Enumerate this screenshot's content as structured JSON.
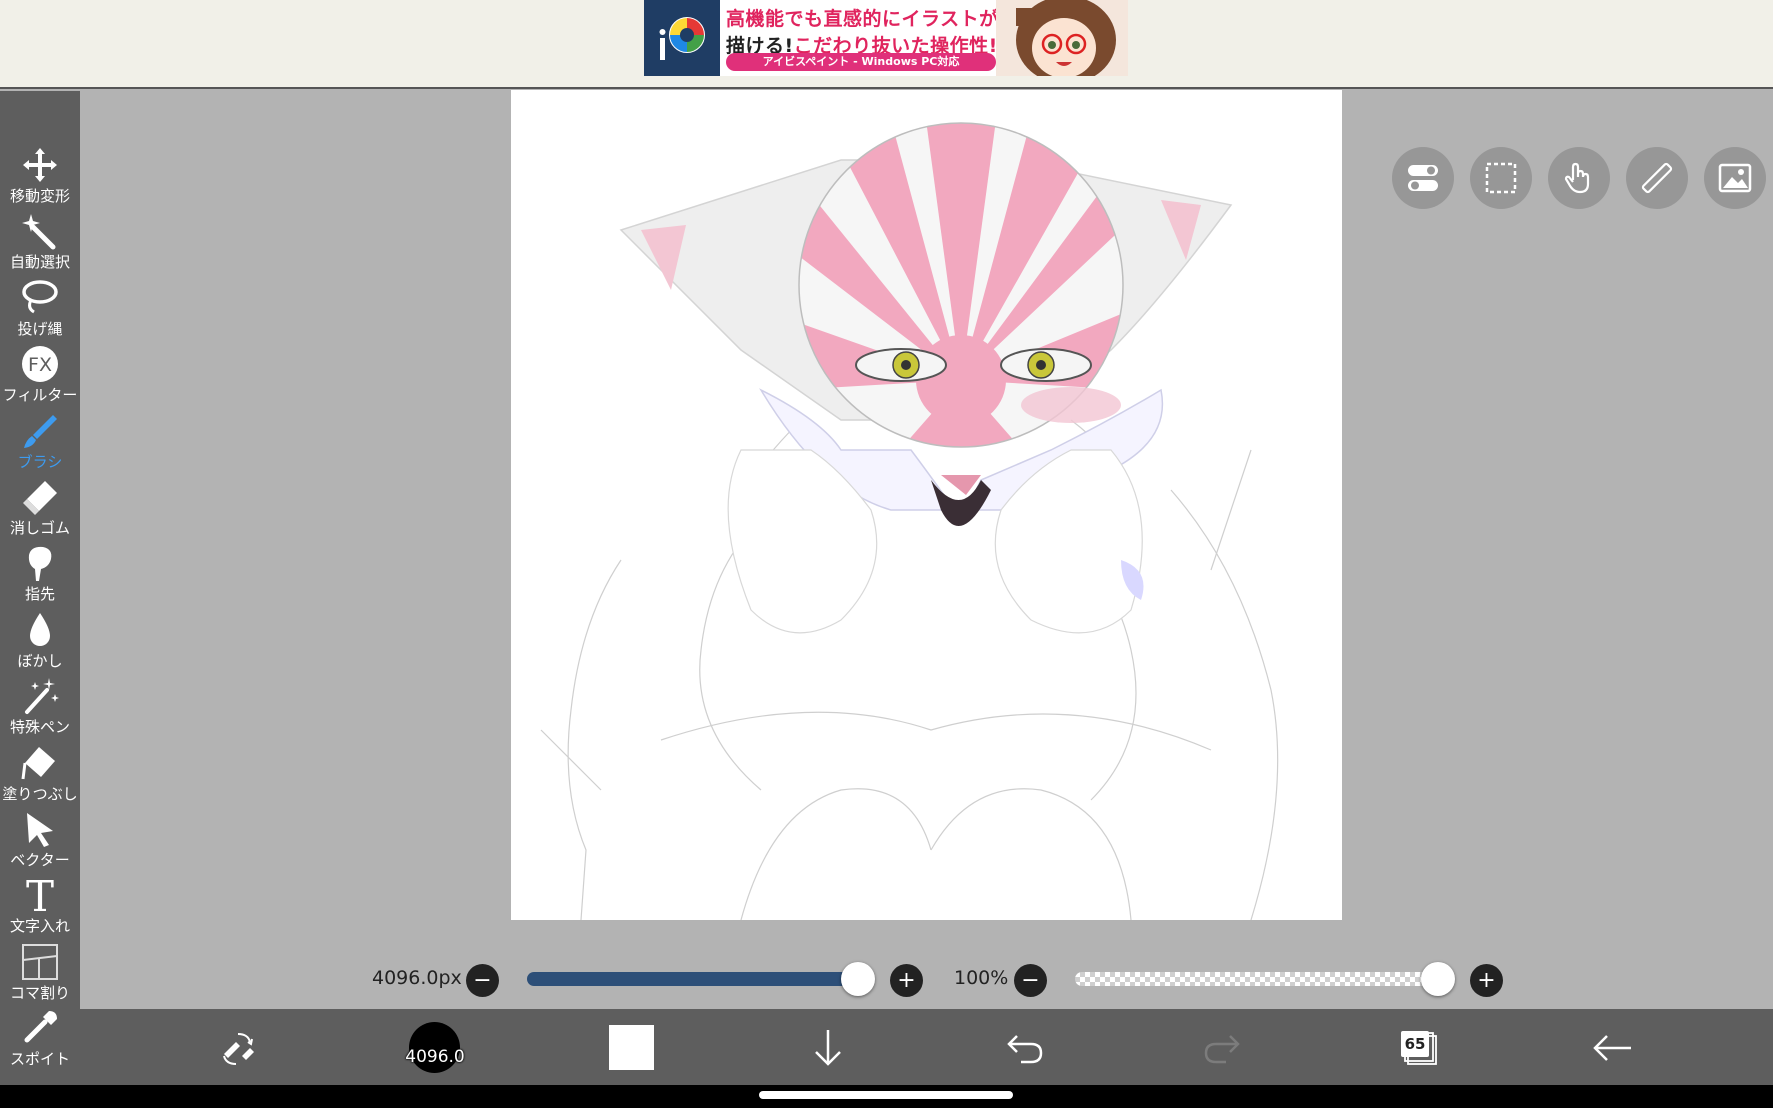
{
  "ad": {
    "line1": "高機能でも直感的にイラストが",
    "line2_a": "描ける!",
    "line2_b": "こだわり抜いた操作性!",
    "pill": "アイビスペイント - Windows PC対応"
  },
  "toolbar": {
    "items": [
      {
        "label": "移動変形",
        "icon": "move-icon"
      },
      {
        "label": "自動選択",
        "icon": "magic-wand-icon"
      },
      {
        "label": "投げ縄",
        "icon": "lasso-icon"
      },
      {
        "label": "フィルター",
        "icon": "fx-icon"
      },
      {
        "label": "ブラシ",
        "icon": "brush-icon",
        "active": true
      },
      {
        "label": "消しゴム",
        "icon": "eraser-icon"
      },
      {
        "label": "指先",
        "icon": "finger-icon"
      },
      {
        "label": "ぼかし",
        "icon": "blur-drop-icon"
      },
      {
        "label": "特殊ペン",
        "icon": "special-pen-icon"
      },
      {
        "label": "塗りつぶし",
        "icon": "fill-bucket-icon"
      },
      {
        "label": "ベクター",
        "icon": "vector-arrow-icon"
      },
      {
        "label": "文字入れ",
        "icon": "text-icon"
      },
      {
        "label": "コマ割り",
        "icon": "frame-divider-icon"
      },
      {
        "label": "スポイト",
        "icon": "eyedropper-icon"
      }
    ],
    "active_color": "#3d9bef"
  },
  "quick_buttons": [
    "toggle-icon",
    "selection-icon",
    "hand-icon",
    "ruler-icon",
    "image-icon"
  ],
  "sliders": {
    "brush_size": "4096.0px",
    "brush_size_fraction": 1.0,
    "opacity": "100%",
    "opacity_fraction": 1.0
  },
  "bottom": {
    "brush_size_short": "4096.0",
    "layers_count": "65",
    "primary_color": "#ffffff"
  }
}
